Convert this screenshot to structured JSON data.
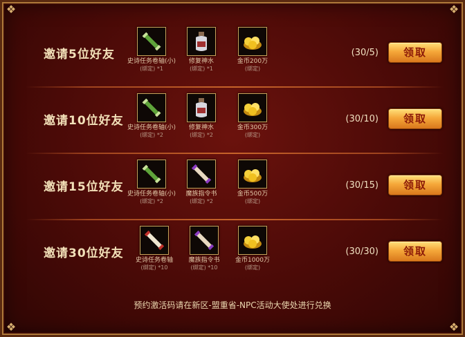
{
  "rows": [
    {
      "title": "邀请5位好友",
      "progress": "(30/5)",
      "button": "领取",
      "items": [
        {
          "name": "史诗任务卷轴(小)",
          "sub": "(绑定) *1",
          "icon": "green-scroll-icon"
        },
        {
          "name": "修复神水",
          "sub": "(绑定) *1",
          "icon": "potion-bottle-icon"
        },
        {
          "name": "金币200万",
          "sub": "(绑定)",
          "icon": "gold-coins-icon"
        }
      ]
    },
    {
      "title": "邀请10位好友",
      "progress": "(30/10)",
      "button": "领取",
      "items": [
        {
          "name": "史诗任务卷轴(小)",
          "sub": "(绑定) *2",
          "icon": "green-scroll-icon"
        },
        {
          "name": "修复神水",
          "sub": "(绑定) *2",
          "icon": "potion-bottle-icon"
        },
        {
          "name": "金币300万",
          "sub": "(绑定)",
          "icon": "gold-coins-icon"
        }
      ]
    },
    {
      "title": "邀请15位好友",
      "progress": "(30/15)",
      "button": "领取",
      "items": [
        {
          "name": "史诗任务卷轴(小)",
          "sub": "(绑定) *2",
          "icon": "green-scroll-icon"
        },
        {
          "name": "魔族指令书",
          "sub": "(绑定) *2",
          "icon": "purple-scroll-icon"
        },
        {
          "name": "金币500万",
          "sub": "(绑定)",
          "icon": "gold-coins-icon"
        }
      ]
    },
    {
      "title": "邀请30位好友",
      "progress": "(30/30)",
      "button": "领取",
      "items": [
        {
          "name": "史诗任务卷轴",
          "sub": "(绑定) *10",
          "icon": "red-scroll-icon"
        },
        {
          "name": "魔族指令书",
          "sub": "(绑定) *10",
          "icon": "purple-scroll-icon"
        },
        {
          "name": "金币1000万",
          "sub": "(绑定)",
          "icon": "gold-coins-icon"
        }
      ]
    }
  ],
  "footer": "预约激活码请在新区-盟重省-NPC活动大使处进行兑换",
  "colors": {
    "background": "#4a0a07",
    "frame_gold": "#b07a3a",
    "title_text": "#f2e0b8",
    "button_gold": "#f5a83a",
    "button_text": "#8c1a08"
  }
}
